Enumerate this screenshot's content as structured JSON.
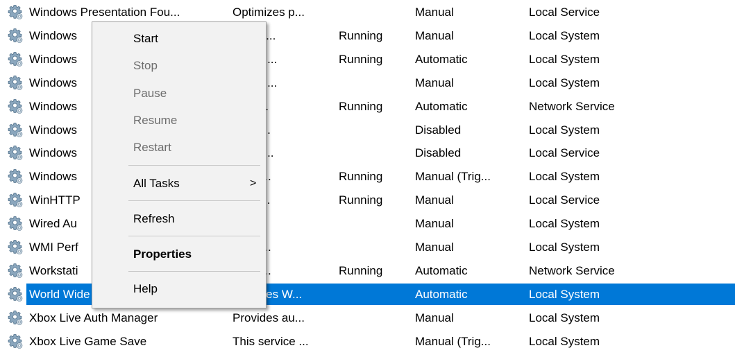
{
  "services": [
    {
      "name": "Windows Presentation Fou...",
      "desc": "Optimizes p...",
      "status": "",
      "startup": "Manual",
      "logon": "Local Service"
    },
    {
      "name": "Windows",
      "desc": "Windo...",
      "status": "Running",
      "startup": "Manual",
      "logon": "Local System"
    },
    {
      "name": "Windows",
      "desc": "ervice ...",
      "status": "Running",
      "startup": "Automatic",
      "logon": "Local System"
    },
    {
      "name": "Windows",
      "desc": "ervice ...",
      "status": "",
      "startup": "Manual",
      "logon": "Local System"
    },
    {
      "name": "Windows",
      "desc": "ws R...",
      "status": "Running",
      "startup": "Automatic",
      "logon": "Network Service"
    },
    {
      "name": "Windows",
      "desc": "es co...",
      "status": "",
      "startup": "Disabled",
      "logon": "Local System"
    },
    {
      "name": "Windows",
      "desc": "ains d...",
      "status": "",
      "startup": "Disabled",
      "logon": "Local Service"
    },
    {
      "name": "Windows",
      "desc": "s the ...",
      "status": "Running",
      "startup": "Manual (Trig...",
      "logon": "Local System"
    },
    {
      "name": "WinHTTP",
      "desc": "TTP i...",
      "status": "Running",
      "startup": "Manual",
      "logon": "Local Service"
    },
    {
      "name": "Wired Au",
      "desc": "ired ...",
      "status": "",
      "startup": "Manual",
      "logon": "Local System"
    },
    {
      "name": "WMI Perf",
      "desc": "es pe...",
      "status": "",
      "startup": "Manual",
      "logon": "Local System"
    },
    {
      "name": "Workstati",
      "desc": "s and...",
      "status": "Running",
      "startup": "Automatic",
      "logon": "Network Service"
    },
    {
      "name": "World Wide Web Publishin...",
      "desc": "Provides W...",
      "status": "",
      "startup": "Automatic",
      "logon": "Local System",
      "selected": true
    },
    {
      "name": "Xbox Live Auth Manager",
      "desc": "Provides au...",
      "status": "",
      "startup": "Manual",
      "logon": "Local System"
    },
    {
      "name": "Xbox Live Game Save",
      "desc": "This service ...",
      "status": "",
      "startup": "Manual (Trig...",
      "logon": "Local System"
    }
  ],
  "context_menu": {
    "start": "Start",
    "stop": "Stop",
    "pause": "Pause",
    "resume": "Resume",
    "restart": "Restart",
    "all_tasks": "All Tasks",
    "all_tasks_arrow": ">",
    "refresh": "Refresh",
    "properties": "Properties",
    "help": "Help"
  },
  "icon": "service-gear-icon",
  "colors": {
    "selection": "#0078d7",
    "menu_bg": "#f2f2f2",
    "disabled_text": "#6d6d6d"
  }
}
